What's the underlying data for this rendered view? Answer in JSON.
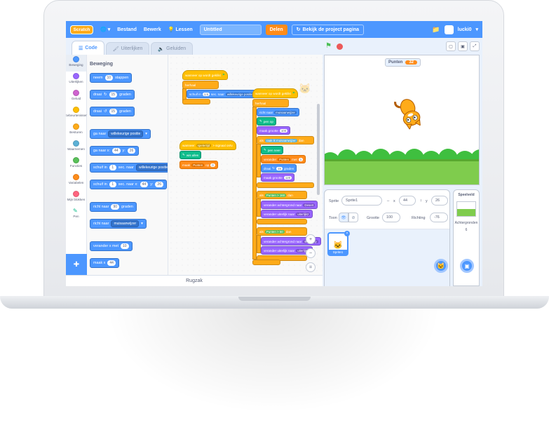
{
  "menubar": {
    "logo": "Scratch",
    "file": "Bestand",
    "edit": "Bewerk",
    "tutorials": "Lessen",
    "project_title": "Untitled",
    "share": "Delen",
    "see_project": "Bekijk de project pagina",
    "username": "lucki0"
  },
  "tabs": {
    "code": "Code",
    "costumes": "Uiterlijken",
    "sounds": "Geluiden"
  },
  "categories": [
    {
      "label": "Beweging",
      "color": "#4c97ff"
    },
    {
      "label": "Uiterlijken",
      "color": "#9966ff"
    },
    {
      "label": "Geluid",
      "color": "#cf63cf"
    },
    {
      "label": "Gebeurtenissen",
      "color": "#ffbf00"
    },
    {
      "label": "Besturen",
      "color": "#ffab19"
    },
    {
      "label": "Waarnemen",
      "color": "#5cb1d6"
    },
    {
      "label": "Functies",
      "color": "#59c059"
    },
    {
      "label": "Variabelen",
      "color": "#ff8c1a"
    },
    {
      "label": "Mijn blokken",
      "color": "#ff6680"
    },
    {
      "label": "Pen",
      "color": "#0fbd8c"
    }
  ],
  "palette": {
    "heading": "Beweging",
    "move": {
      "pre": "neem",
      "val": "10",
      "post": "stappen"
    },
    "turn_right": {
      "pre": "draai",
      "val": "15",
      "post": "graden"
    },
    "turn_left": {
      "pre": "draai",
      "val": "15",
      "post": "graden"
    },
    "goto": {
      "pre": "ga naar",
      "dd": "willekeurige positie"
    },
    "goto_xy": {
      "pre": "ga naar x:",
      "x": "44",
      "mid": "y:",
      "y": "26"
    },
    "glide_to": {
      "pre": "schuif in",
      "val": "1",
      "mid": "sec. naar",
      "dd": "willekeurige positie"
    },
    "glide_xy": {
      "pre": "schuif in",
      "val": "1",
      "mid": "sec. naar x:",
      "x": "44",
      "ymid": "y:",
      "y": "26"
    },
    "point_dir": {
      "pre": "richt naar",
      "val": "90",
      "post": "graden"
    },
    "point_towards": {
      "pre": "richt naar",
      "dd": "muisaanwijzer"
    },
    "change_x": {
      "pre": "verander x met",
      "val": "10"
    },
    "set_x": {
      "pre": "maak x",
      "val": "44"
    }
  },
  "scripts": {
    "s1_hat": "wanneer op  wordt geklikt",
    "s1_forever": "herhaal",
    "s1_glide": "schuif in",
    "s1_glide_val": "1.5",
    "s1_glide_mid": "sec. naar",
    "s1_glide_dd": "willekeurige positie",
    "s2_hat": "wanneer",
    "s2_hat_dd": "spelertijd",
    "s2_hat_post": "> signaal ontv.",
    "s2_pen": "wis alles",
    "s2_var": "maak",
    "s2_var_dd": "Punten",
    "s2_var_mid": "op",
    "s2_var_val": "0",
    "s3_hat": "wanneer op  wordt geklikt",
    "s3_forever": "herhaal",
    "s3_point": "richt naar",
    "s3_point_dd": "muisaanwijzer",
    "s3_pendown": "pen op",
    "s3_size": "maak grootte",
    "s3_size_val": "100",
    "s3_if": "als",
    "s3_if_touch": "raak ik",
    "s3_if_touch_dd": "muisaanwijzer",
    "s3_if_then": "dan",
    "s3_pen2": "pen neer",
    "s3_change": "verander",
    "s3_change_dd": "Punten",
    "s3_change_mid": "met",
    "s3_change_val": "1",
    "s3_turn": "draai",
    "s3_turn_val": "15",
    "s3_turn_post": "graden",
    "s3_size2": "maak grootte",
    "s3_size2_val": "120",
    "s3_if2": "als",
    "s3_if2_var": "Punten",
    "s3_if2_op": ">",
    "s3_if2_val": "160",
    "s3_if2_then": "dan",
    "s3_backdrop": "verander achtergrond naar",
    "s3_backdrop_dd": "Desert",
    "s3_costume": "verander uiterlijk naar",
    "s3_costume_dd": "uiterlijk2",
    "s3_if3": "als",
    "s3_if3_var": "Punten",
    "s3_if3_op": ">",
    "s3_if3_val": "50",
    "s3_if3_then": "dan",
    "s3_backdrop2": "verander achtergrond naar",
    "s3_backdrop2_dd": "Blue Sky",
    "s3_costume2": "verander uiterlijk naar",
    "s3_costume2_dd": "uiterlijk2"
  },
  "backpack": "Rugzak",
  "stage": {
    "monitor_label": "Punten",
    "monitor_value": "32"
  },
  "sprite_info": {
    "sprite_label": "Sprite",
    "sprite_name": "Sprite1",
    "x_label": "x",
    "x": "44",
    "y_label": "y",
    "y": "26",
    "show_label": "Toon",
    "size_label": "Grootte",
    "size": "100",
    "direction_label": "Richting",
    "direction": "-76"
  },
  "sprites": [
    {
      "name": "Sprite1"
    }
  ],
  "stage_pane": {
    "title": "Speelveld",
    "backdrops_label": "Achtergronden",
    "backdrops_count": "6"
  }
}
